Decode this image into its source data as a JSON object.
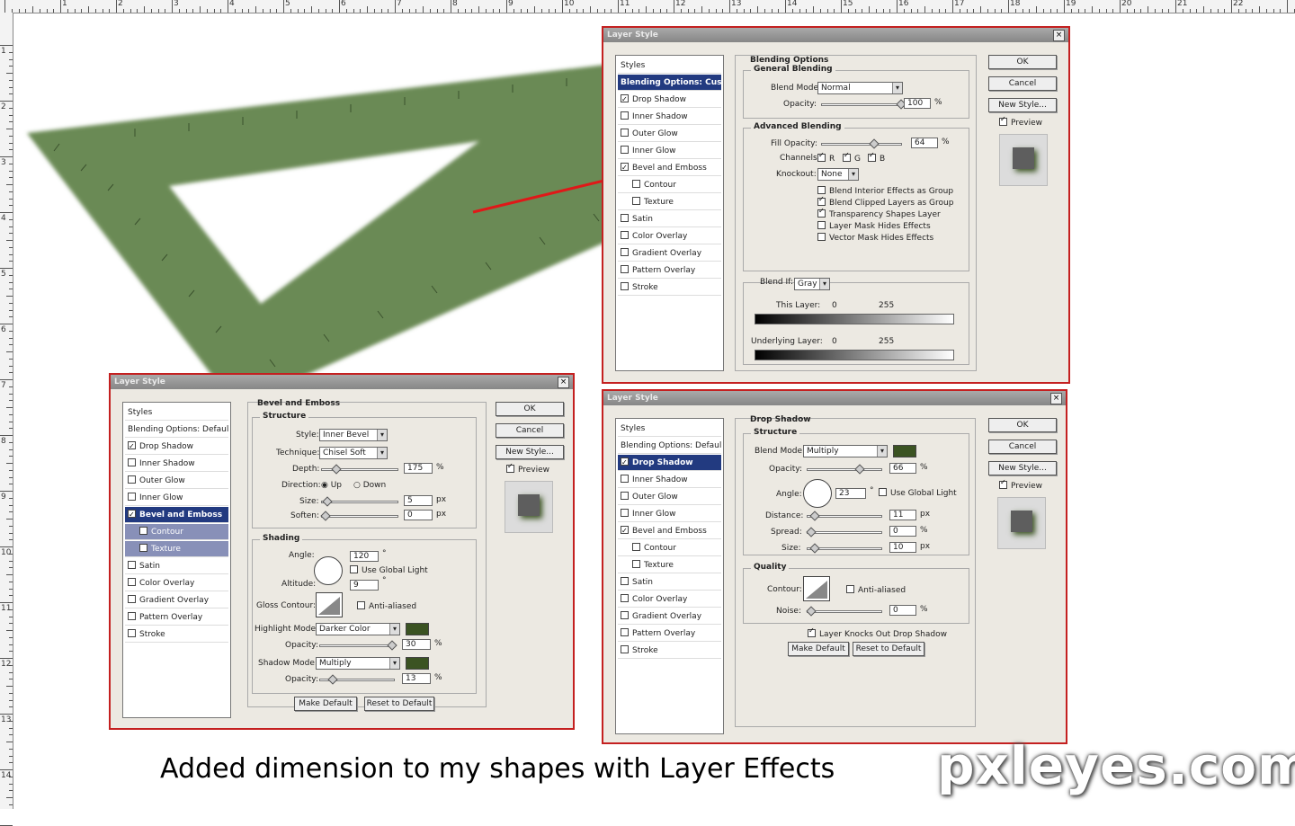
{
  "ruler": {
    "top_labels": [
      "1",
      "2",
      "3",
      "4",
      "5",
      "6",
      "7",
      "8",
      "9",
      "10",
      "11",
      "12",
      "13",
      "14",
      "15",
      "16",
      "17",
      "18",
      "19",
      "20",
      "21",
      "22"
    ],
    "left_labels": [
      "1",
      "2",
      "3",
      "4",
      "5",
      "6",
      "7",
      "8",
      "9",
      "10",
      "11",
      "12",
      "13",
      "14"
    ]
  },
  "colors": {
    "shape_green": "#6a8a55",
    "annotation_red": "#e01818",
    "swatch_green": "#3b5322"
  },
  "dialog_top": {
    "title": "Layer Style",
    "close": "×",
    "styles_header": "Styles",
    "items": [
      {
        "label": "Blending Options: Custom",
        "checked": null,
        "selected": true
      },
      {
        "label": "Drop Shadow",
        "checked": true
      },
      {
        "label": "Inner Shadow",
        "checked": false
      },
      {
        "label": "Outer Glow",
        "checked": false
      },
      {
        "label": "Inner Glow",
        "checked": false
      },
      {
        "label": "Bevel and Emboss",
        "checked": true
      },
      {
        "label": "Contour",
        "checked": false,
        "sub": true
      },
      {
        "label": "Texture",
        "checked": false,
        "sub": true
      },
      {
        "label": "Satin",
        "checked": false
      },
      {
        "label": "Color Overlay",
        "checked": false
      },
      {
        "label": "Gradient Overlay",
        "checked": false
      },
      {
        "label": "Pattern Overlay",
        "checked": false
      },
      {
        "label": "Stroke",
        "checked": false
      }
    ],
    "section_title": "Blending Options",
    "general_title": "General Blending",
    "blend_mode_label": "Blend Mode:",
    "blend_mode_value": "Normal",
    "opacity_label": "Opacity:",
    "opacity_value": "100",
    "pct": "%",
    "advanced_title": "Advanced Blending",
    "fill_opacity_label": "Fill Opacity:",
    "fill_opacity_value": "64",
    "channels_label": "Channels:",
    "channel_r": "R",
    "channel_g": "G",
    "channel_b": "B",
    "knockout_label": "Knockout:",
    "knockout_value": "None",
    "options": [
      {
        "label": "Blend Interior Effects as Group",
        "checked": false
      },
      {
        "label": "Blend Clipped Layers as Group",
        "checked": true
      },
      {
        "label": "Transparency Shapes Layer",
        "checked": true
      },
      {
        "label": "Layer Mask Hides Effects",
        "checked": false
      },
      {
        "label": "Vector Mask Hides Effects",
        "checked": false
      }
    ],
    "blend_if_label": "Blend If:",
    "blend_if_value": "Gray",
    "this_layer_label": "This Layer:",
    "underlying_label": "Underlying Layer:",
    "range_min": "0",
    "range_max": "255",
    "ok": "OK",
    "cancel": "Cancel",
    "new_style": "New Style...",
    "preview": "Preview"
  },
  "dialog_left": {
    "title": "Layer Style",
    "close": "×",
    "styles_header": "Styles",
    "items": [
      {
        "label": "Blending Options: Default",
        "checked": null
      },
      {
        "label": "Drop Shadow",
        "checked": true
      },
      {
        "label": "Inner Shadow",
        "checked": false
      },
      {
        "label": "Outer Glow",
        "checked": false
      },
      {
        "label": "Inner Glow",
        "checked": false
      },
      {
        "label": "Bevel and Emboss",
        "checked": true,
        "selected": true
      },
      {
        "label": "Contour",
        "checked": false,
        "sub": true,
        "subsel": true
      },
      {
        "label": "Texture",
        "checked": false,
        "sub": true,
        "subsel": true
      },
      {
        "label": "Satin",
        "checked": false
      },
      {
        "label": "Color Overlay",
        "checked": false
      },
      {
        "label": "Gradient Overlay",
        "checked": false
      },
      {
        "label": "Pattern Overlay",
        "checked": false
      },
      {
        "label": "Stroke",
        "checked": false
      }
    ],
    "section_title": "Bevel and Emboss",
    "structure_title": "Structure",
    "style_label": "Style:",
    "style_value": "Inner Bevel",
    "technique_label": "Technique:",
    "technique_value": "Chisel Soft",
    "depth_label": "Depth:",
    "depth_value": "175",
    "direction_label": "Direction:",
    "dir_up": "Up",
    "dir_down": "Down",
    "size_label": "Size:",
    "size_value": "5",
    "soften_label": "Soften:",
    "soften_value": "0",
    "px": "px",
    "pct": "%",
    "shading_title": "Shading",
    "angle_label": "Angle:",
    "angle_value": "120",
    "deg": "°",
    "global_light": "Use Global Light",
    "altitude_label": "Altitude:",
    "altitude_value": "9",
    "gloss_label": "Gloss Contour:",
    "antialiased": "Anti-aliased",
    "highlight_label": "Highlight Mode:",
    "highlight_value": "Darker Color",
    "opacity_label": "Opacity:",
    "highlight_opacity": "30",
    "shadow_label": "Shadow Mode:",
    "shadow_value": "Multiply",
    "shadow_opacity": "13",
    "make_default": "Make Default",
    "reset_default": "Reset to Default",
    "ok": "OK",
    "cancel": "Cancel",
    "new_style": "New Style...",
    "preview": "Preview"
  },
  "dialog_right": {
    "title": "Layer Style",
    "close": "×",
    "styles_header": "Styles",
    "items": [
      {
        "label": "Blending Options: Default",
        "checked": null
      },
      {
        "label": "Drop Shadow",
        "checked": true,
        "selected": true
      },
      {
        "label": "Inner Shadow",
        "checked": false
      },
      {
        "label": "Outer Glow",
        "checked": false
      },
      {
        "label": "Inner Glow",
        "checked": false
      },
      {
        "label": "Bevel and Emboss",
        "checked": true
      },
      {
        "label": "Contour",
        "checked": false,
        "sub": true
      },
      {
        "label": "Texture",
        "checked": false,
        "sub": true
      },
      {
        "label": "Satin",
        "checked": false
      },
      {
        "label": "Color Overlay",
        "checked": false
      },
      {
        "label": "Gradient Overlay",
        "checked": false
      },
      {
        "label": "Pattern Overlay",
        "checked": false
      },
      {
        "label": "Stroke",
        "checked": false
      }
    ],
    "section_title": "Drop Shadow",
    "structure_title": "Structure",
    "blend_mode_label": "Blend Mode:",
    "blend_mode_value": "Multiply",
    "opacity_label": "Opacity:",
    "opacity_value": "66",
    "angle_label": "Angle:",
    "angle_value": "23",
    "deg": "°",
    "global_light": "Use Global Light",
    "distance_label": "Distance:",
    "distance_value": "11",
    "spread_label": "Spread:",
    "spread_value": "0",
    "size_label": "Size:",
    "size_value": "10",
    "px": "px",
    "pct": "%",
    "quality_title": "Quality",
    "contour_label": "Contour:",
    "antialiased": "Anti-aliased",
    "noise_label": "Noise:",
    "noise_value": "0",
    "knocks_out": "Layer Knocks Out Drop Shadow",
    "make_default": "Make Default",
    "reset_default": "Reset to Default",
    "ok": "OK",
    "cancel": "Cancel",
    "new_style": "New Style...",
    "preview": "Preview"
  },
  "caption": "Added dimension to my shapes with Layer Effects",
  "watermark": "pxleyes.com"
}
